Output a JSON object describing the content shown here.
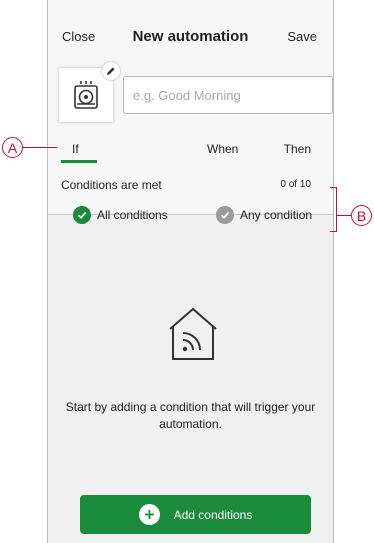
{
  "header": {
    "close_label": "Close",
    "title": "New automation",
    "save_label": "Save"
  },
  "name_field": {
    "placeholder": "e.g. Good Morning",
    "value": ""
  },
  "tabs": [
    {
      "label": "If",
      "active": true
    },
    {
      "label": "When"
    },
    {
      "label": "Then"
    }
  ],
  "conditions": {
    "label": "Conditions are met",
    "count": "0 of 10",
    "options": [
      {
        "label": "All conditions",
        "selected": true
      },
      {
        "label": "Any condition",
        "selected": false
      }
    ]
  },
  "empty_state": {
    "message": "Start by adding a condition that will trigger your automation."
  },
  "add_button": {
    "label": "Add conditions"
  },
  "callouts": {
    "a": "A",
    "b": "B"
  },
  "colors": {
    "accent": "#1a8a3c",
    "callout": "#c8102e",
    "unselected": "#9a9a9a"
  }
}
